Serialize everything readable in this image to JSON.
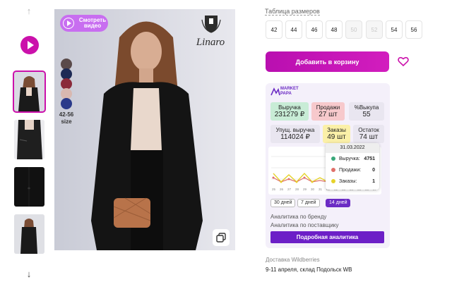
{
  "gallery": {
    "thumbnails": [
      "photo-1",
      "photo-2",
      "photo-3",
      "photo-4"
    ],
    "watch_video_label": "Смотреть видео",
    "brand_name": "Linaro",
    "size_range": "42-56",
    "size_word": "size"
  },
  "sizes": {
    "title": "Таблица размеров",
    "items": [
      {
        "label": "42",
        "available": true
      },
      {
        "label": "44",
        "available": true
      },
      {
        "label": "46",
        "available": true
      },
      {
        "label": "48",
        "available": true
      },
      {
        "label": "50",
        "available": false
      },
      {
        "label": "52",
        "available": false
      },
      {
        "label": "54",
        "available": true
      },
      {
        "label": "56",
        "available": true
      }
    ]
  },
  "cart": {
    "add_label": "Добавить в корзину"
  },
  "marketpapa": {
    "logo_line1": "MARKET",
    "logo_line2": "PAPA",
    "stats": {
      "revenue_label": "Выручка",
      "revenue_value": "231279 ₽",
      "sales_label": "Продажи",
      "sales_value": "27 шт",
      "buyout_label": "%Выкупа",
      "buyout_value": "55",
      "lost_label": "Упущ. выручка",
      "lost_value": "114024 ₽",
      "orders_label": "Заказы",
      "orders_value": "49 шт",
      "stock_label": "Остаток",
      "stock_value": "74 шт"
    },
    "graph": {
      "x_ticks": [
        "25",
        "26",
        "27",
        "28",
        "29",
        "30",
        "31",
        "01",
        "02",
        "03",
        "04",
        "05",
        "06",
        "07"
      ]
    },
    "tooltip": {
      "date": "31.03.2022",
      "rows": [
        {
          "label": "Выручка:",
          "value": "4751",
          "color": "#3aa87a"
        },
        {
          "label": "Продажи:",
          "value": "0",
          "color": "#e0706a"
        },
        {
          "label": "Заказы:",
          "value": "1",
          "color": "#e6d22a"
        }
      ]
    },
    "periods": [
      "30 дней",
      "7 дней",
      "14 дней"
    ],
    "active_period": "14 дней",
    "links": [
      "Аналитика по бренду",
      "Аналитика по поставщику"
    ],
    "detail_button": "Подробная аналитика"
  },
  "delivery": {
    "title": "Доставка Wildberries",
    "text": "9-11 апреля, склад Подольск WB"
  },
  "colors": {
    "accent": "#cb11ab",
    "mp_purple": "#6c1fc7",
    "revenue_bg": "#c8ecd6",
    "sales_bg": "#f7c9cc",
    "orders_bg": "#fbf0a8",
    "neutral_bg": "#e9e6f0"
  }
}
